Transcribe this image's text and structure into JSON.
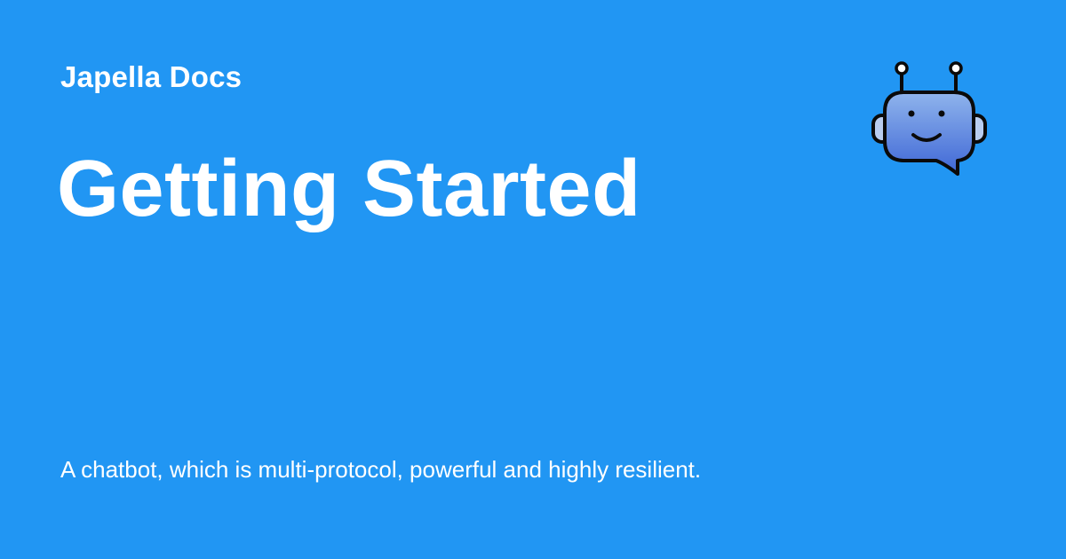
{
  "site": {
    "name": "Japella Docs"
  },
  "page": {
    "title": "Getting Started",
    "description": "A chatbot, which is multi-protocol, powerful and highly resilient."
  },
  "logo": {
    "icon": "robot-chat-icon"
  },
  "colors": {
    "background": "#2196f3",
    "text": "#ffffff",
    "logo_fill_top": "#8fb4ec",
    "logo_fill_bottom": "#3f67d6",
    "logo_outline": "#0a0a0a"
  }
}
